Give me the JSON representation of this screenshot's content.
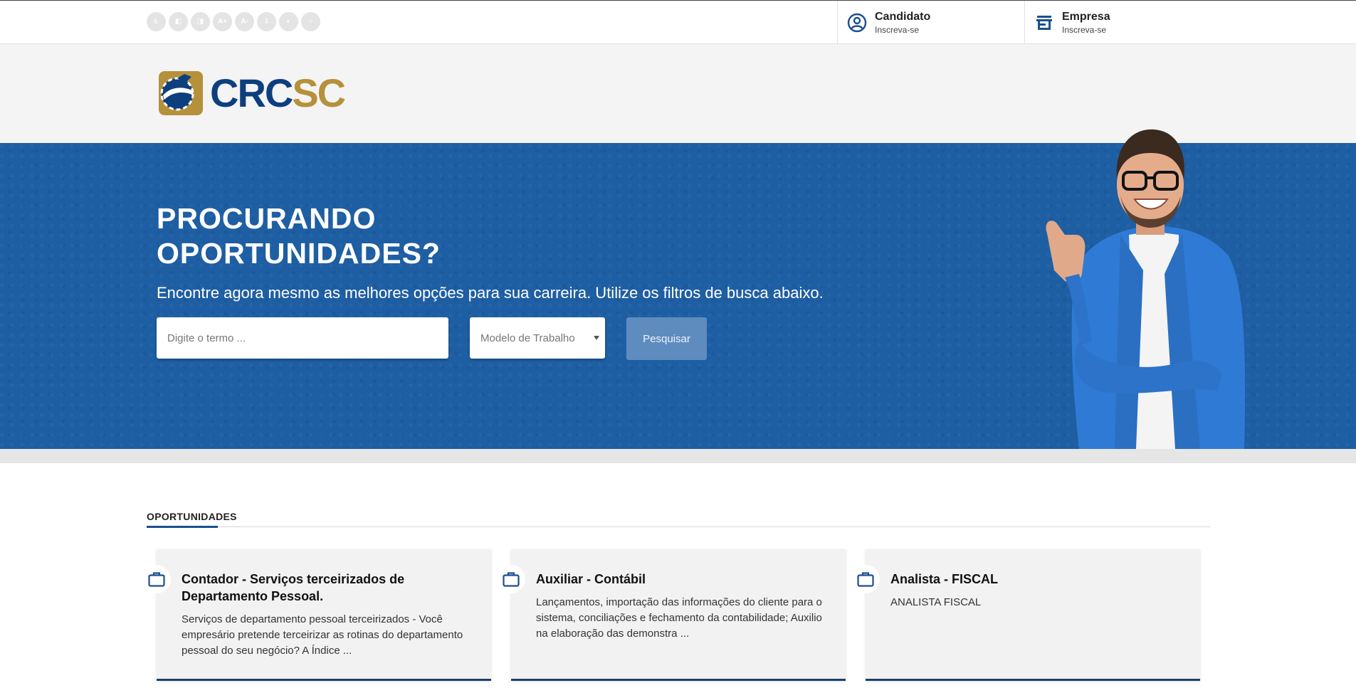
{
  "accessibility": {
    "buttons": [
      {
        "icon": "accessibility-icon",
        "glyph": "♿"
      },
      {
        "icon": "libras-icon",
        "glyph": "◧"
      },
      {
        "icon": "reader-icon",
        "glyph": "◨"
      },
      {
        "icon": "font-increase-icon",
        "glyph": "A+"
      },
      {
        "icon": "font-decrease-icon",
        "glyph": "A-"
      },
      {
        "icon": "download-icon",
        "glyph": "⇩"
      },
      {
        "icon": "contrast-icon",
        "glyph": "◐"
      },
      {
        "icon": "reset-icon",
        "glyph": "○"
      }
    ]
  },
  "header": {
    "candidate": {
      "title": "Candidato",
      "subtitle": "Inscreva-se",
      "icon": "user-circle-icon"
    },
    "company": {
      "title": "Empresa",
      "subtitle": "Inscreva-se",
      "icon": "store-icon"
    }
  },
  "logo": {
    "part1": "CRC",
    "part2": "SC"
  },
  "hero": {
    "title": "PROCURANDO OPORTUNIDADES?",
    "subtitle": "Encontre agora mesmo as melhores opções para sua carreira. Utilize os filtros de busca abaixo.",
    "search_placeholder": "Digite o termo ...",
    "select_label": "Modelo de Trabalho",
    "button_label": "Pesquisar"
  },
  "opportunities": {
    "heading": "OPORTUNIDADES",
    "cards": [
      {
        "title": "Contador - Serviços terceirizados de Departamento Pessoal.",
        "description": "Serviços de departamento pessoal terceirizados - Você empresário pretende terceirizar as rotinas do departamento pessoal do seu negócio? A Índice ..."
      },
      {
        "title": "Auxiliar - Contábil",
        "description": "Lançamentos, importação das informações do cliente para o sistema, conciliações e fechamento da contabilidade; Auxilio na elaboração das demonstra ..."
      },
      {
        "title": "Analista - FISCAL",
        "description": "ANALISTA FISCAL"
      }
    ]
  },
  "colors": {
    "primary": "#1e5ea3",
    "navy": "#0d3f7f",
    "gold": "#b6913b"
  }
}
